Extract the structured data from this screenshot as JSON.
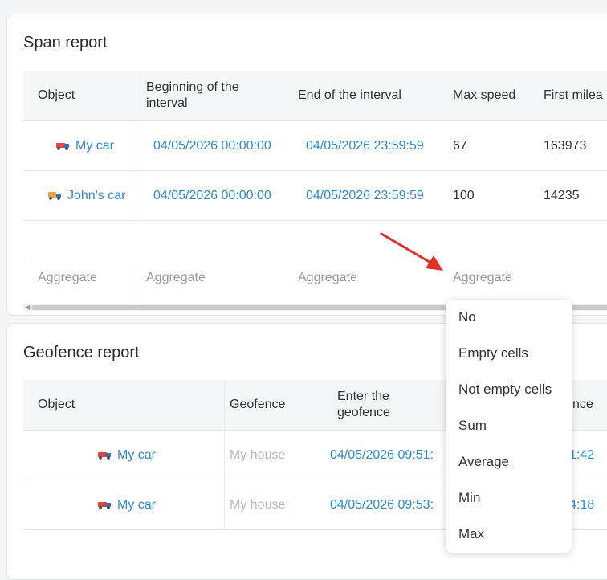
{
  "span_report": {
    "title": "Span report",
    "headers": {
      "object": "Object",
      "beginning_line1": "Beginning of the",
      "beginning_line2": "interval",
      "end": "End of the interval",
      "max_speed": "Max speed",
      "first_mileage": "First milea"
    },
    "rows": [
      {
        "object": "My car",
        "begin": "04/05/2026 00:00:00",
        "end": "04/05/2026 23:59:59",
        "max_speed": "67",
        "first_mileage": "163973"
      },
      {
        "object": "John's car",
        "begin": "04/05/2026 00:00:00",
        "end": "04/05/2026 23:59:59",
        "max_speed": "100",
        "first_mileage": "14235"
      }
    ],
    "aggregate_label": "Aggregate"
  },
  "geofence_report": {
    "title": "Geofence report",
    "headers": {
      "object": "Object",
      "geofence": "Geofence",
      "enter_line1": "Enter the",
      "enter_line2": "geofence",
      "partial": "nce"
    },
    "rows": [
      {
        "object": "My car",
        "geofence": "My house",
        "enter": "04/05/2026 09:51:",
        "partial": "1:42"
      },
      {
        "object": "My car",
        "geofence": "My house",
        "enter": "04/05/2026 09:53:",
        "partial": "4:18"
      }
    ]
  },
  "aggregate_dropdown": {
    "options": [
      "No",
      "Empty cells",
      "Not empty cells",
      "Sum",
      "Average",
      "Min",
      "Max"
    ]
  },
  "colors": {
    "link": "#2b8ad6",
    "arrow": "#e0302a",
    "muted": "#b7b9bd"
  }
}
